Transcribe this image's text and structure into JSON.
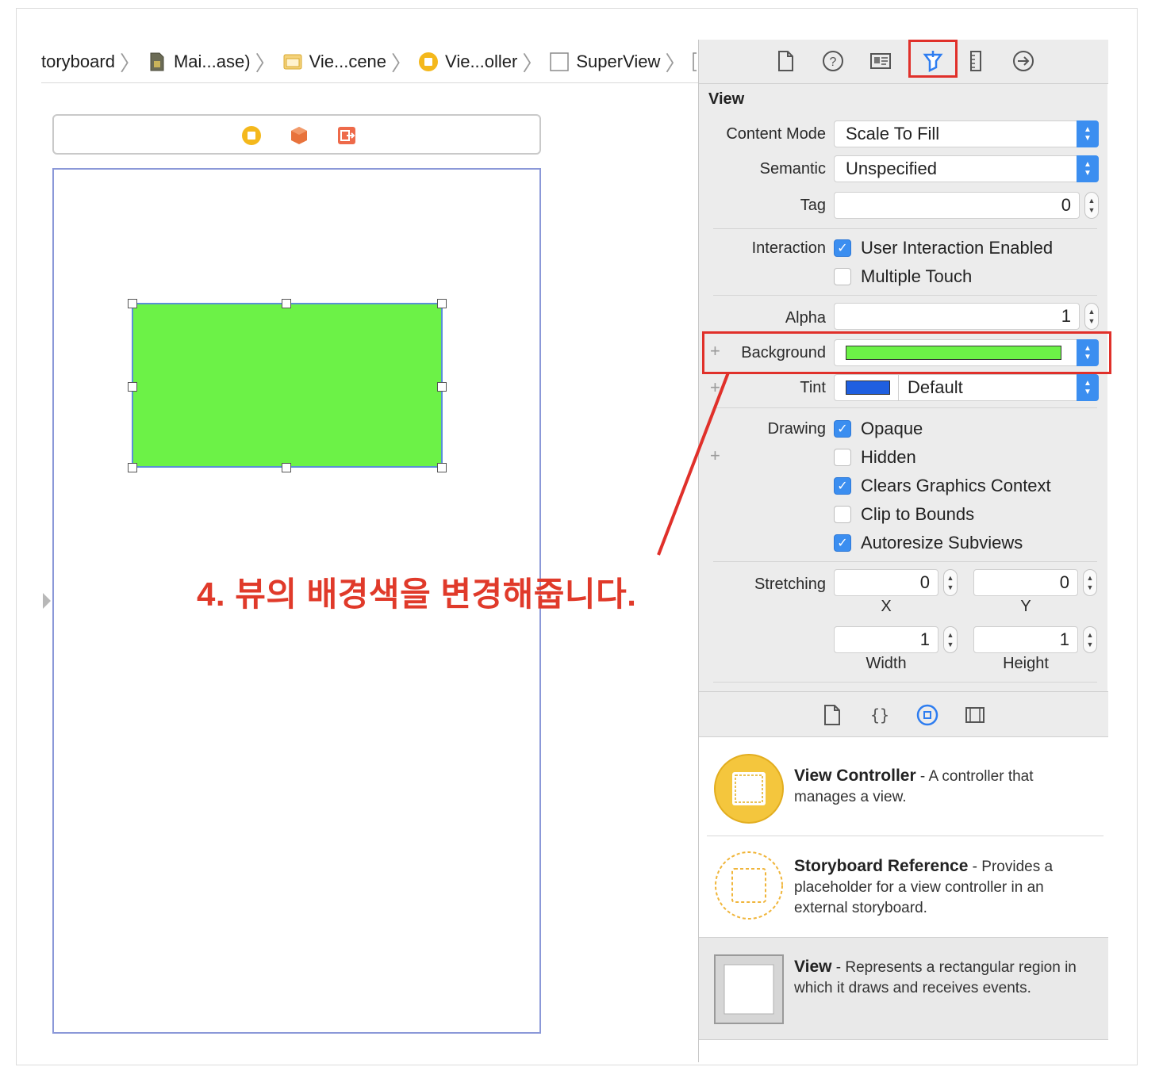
{
  "breadcrumb": {
    "items": [
      "toryboard",
      "Mai...ase)",
      "Vie...cene",
      "Vie...oller",
      "SuperView"
    ]
  },
  "annotation": "4. 뷰의 배경색을 변경해줍니다.",
  "inspector": {
    "section_title": "View",
    "content_mode": {
      "label": "Content Mode",
      "value": "Scale To Fill"
    },
    "semantic": {
      "label": "Semantic",
      "value": "Unspecified"
    },
    "tag": {
      "label": "Tag",
      "value": "0"
    },
    "interaction": {
      "label": "Interaction",
      "options": [
        {
          "label": "User Interaction Enabled",
          "checked": true
        },
        {
          "label": "Multiple Touch",
          "checked": false
        }
      ]
    },
    "alpha": {
      "label": "Alpha",
      "value": "1"
    },
    "background": {
      "label": "Background",
      "color": "#6cf247"
    },
    "tint": {
      "label": "Tint",
      "value": "Default",
      "color": "#1f5fe0"
    },
    "drawing": {
      "label": "Drawing",
      "options": [
        {
          "label": "Opaque",
          "checked": true
        },
        {
          "label": "Hidden",
          "checked": false
        },
        {
          "label": "Clears Graphics Context",
          "checked": true
        },
        {
          "label": "Clip to Bounds",
          "checked": false
        },
        {
          "label": "Autoresize Subviews",
          "checked": true
        }
      ]
    },
    "stretching": {
      "label": "Stretching",
      "x": "0",
      "y": "0",
      "width": "1",
      "height": "1",
      "x_label": "X",
      "y_label": "Y",
      "width_label": "Width",
      "height_label": "Height"
    }
  },
  "library": {
    "items": [
      {
        "title": "View Controller",
        "desc": " - A controller that manages a view."
      },
      {
        "title": "Storyboard Reference",
        "desc": " - Provides a placeholder for a view controller in an external storyboard."
      },
      {
        "title": "View",
        "desc": " - Represents a rectangular region in which it draws and receives events."
      }
    ]
  },
  "colors": {
    "accent": "#3b8ef0",
    "highlight": "#e0302a",
    "view_bg": "#6cf247"
  }
}
